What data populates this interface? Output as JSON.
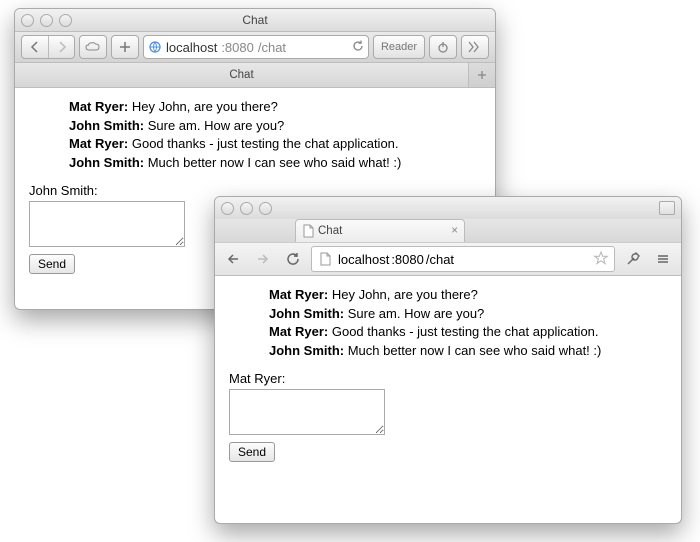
{
  "safari": {
    "title": "Chat",
    "url": {
      "host": "localhost",
      "port": ":8080",
      "path": "/chat"
    },
    "reader_label": "Reader",
    "tab": {
      "label": "Chat"
    },
    "composer_name": "John Smith:",
    "send_label": "Send"
  },
  "chrome": {
    "tab": {
      "label": "Chat"
    },
    "url": {
      "host": "localhost",
      "port": ":8080",
      "path": "/chat"
    },
    "composer_name": "Mat Ryer:",
    "send_label": "Send"
  },
  "messages": [
    {
      "author": "Mat Ryer:",
      "text": " Hey John, are you there?"
    },
    {
      "author": "John Smith:",
      "text": " Sure am. How are you?"
    },
    {
      "author": "Mat Ryer:",
      "text": " Good thanks - just testing the chat application."
    },
    {
      "author": "John Smith:",
      "text": " Much better now I can see who said what! :)"
    }
  ]
}
